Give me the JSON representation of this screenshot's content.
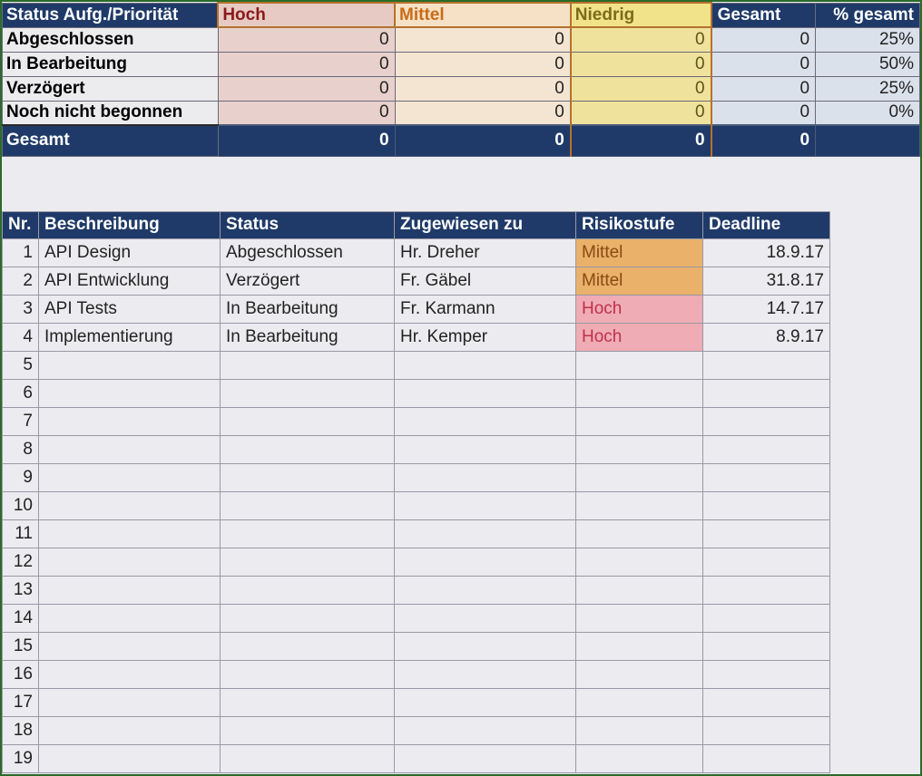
{
  "summary": {
    "headers": {
      "main": "Status Aufg./Priorität",
      "hoch": "Hoch",
      "mittel": "Mittel",
      "niedrig": "Niedrig",
      "gesamt": "Gesamt",
      "pct": "% gesamt"
    },
    "rows": [
      {
        "label": "Abgeschlossen",
        "hoch": "0",
        "mittel": "0",
        "niedrig": "0",
        "gesamt": "0",
        "pct": "25%"
      },
      {
        "label": "In Bearbeitung",
        "hoch": "0",
        "mittel": "0",
        "niedrig": "0",
        "gesamt": "0",
        "pct": "50%"
      },
      {
        "label": "Verzögert",
        "hoch": "0",
        "mittel": "0",
        "niedrig": "0",
        "gesamt": "0",
        "pct": "25%"
      },
      {
        "label": "Noch nicht begonnen",
        "hoch": "0",
        "mittel": "0",
        "niedrig": "0",
        "gesamt": "0",
        "pct": "0%"
      }
    ],
    "total": {
      "label": "Gesamt",
      "hoch": "0",
      "mittel": "0",
      "niedrig": "0",
      "gesamt": "0",
      "pct": ""
    }
  },
  "tasks": {
    "headers": {
      "nr": "Nr.",
      "beschreibung": "Beschreibung",
      "status": "Status",
      "zugewiesen": "Zugewiesen zu",
      "risiko": "Risikostufe",
      "deadline": "Deadline"
    },
    "rows": [
      {
        "nr": "1",
        "beschreibung": "API Design",
        "status": "Abgeschlossen",
        "zugewiesen": "Hr. Dreher",
        "risiko": "Mittel",
        "deadline": "18.9.17"
      },
      {
        "nr": "2",
        "beschreibung": "API Entwicklung",
        "status": "Verzögert",
        "zugewiesen": "Fr. Gäbel",
        "risiko": "Mittel",
        "deadline": "31.8.17"
      },
      {
        "nr": "3",
        "beschreibung": "API Tests",
        "status": "In Bearbeitung",
        "zugewiesen": "Fr. Karmann",
        "risiko": "Hoch",
        "deadline": "14.7.17"
      },
      {
        "nr": "4",
        "beschreibung": "Implementierung",
        "status": "In Bearbeitung",
        "zugewiesen": "Hr. Kemper",
        "risiko": "Hoch",
        "deadline": "8.9.17"
      },
      {
        "nr": "5",
        "beschreibung": "",
        "status": "",
        "zugewiesen": "",
        "risiko": "",
        "deadline": ""
      },
      {
        "nr": "6",
        "beschreibung": "",
        "status": "",
        "zugewiesen": "",
        "risiko": "",
        "deadline": ""
      },
      {
        "nr": "7",
        "beschreibung": "",
        "status": "",
        "zugewiesen": "",
        "risiko": "",
        "deadline": ""
      },
      {
        "nr": "8",
        "beschreibung": "",
        "status": "",
        "zugewiesen": "",
        "risiko": "",
        "deadline": ""
      },
      {
        "nr": "9",
        "beschreibung": "",
        "status": "",
        "zugewiesen": "",
        "risiko": "",
        "deadline": ""
      },
      {
        "nr": "10",
        "beschreibung": "",
        "status": "",
        "zugewiesen": "",
        "risiko": "",
        "deadline": ""
      },
      {
        "nr": "11",
        "beschreibung": "",
        "status": "",
        "zugewiesen": "",
        "risiko": "",
        "deadline": ""
      },
      {
        "nr": "12",
        "beschreibung": "",
        "status": "",
        "zugewiesen": "",
        "risiko": "",
        "deadline": ""
      },
      {
        "nr": "13",
        "beschreibung": "",
        "status": "",
        "zugewiesen": "",
        "risiko": "",
        "deadline": ""
      },
      {
        "nr": "14",
        "beschreibung": "",
        "status": "",
        "zugewiesen": "",
        "risiko": "",
        "deadline": ""
      },
      {
        "nr": "15",
        "beschreibung": "",
        "status": "",
        "zugewiesen": "",
        "risiko": "",
        "deadline": ""
      },
      {
        "nr": "16",
        "beschreibung": "",
        "status": "",
        "zugewiesen": "",
        "risiko": "",
        "deadline": ""
      },
      {
        "nr": "17",
        "beschreibung": "",
        "status": "",
        "zugewiesen": "",
        "risiko": "",
        "deadline": ""
      },
      {
        "nr": "18",
        "beschreibung": "",
        "status": "",
        "zugewiesen": "",
        "risiko": "",
        "deadline": ""
      },
      {
        "nr": "19",
        "beschreibung": "",
        "status": "",
        "zugewiesen": "",
        "risiko": "",
        "deadline": ""
      }
    ]
  },
  "colors": {
    "risk_mittel": "#e9b16a",
    "risk_hoch": "#efacb4"
  }
}
